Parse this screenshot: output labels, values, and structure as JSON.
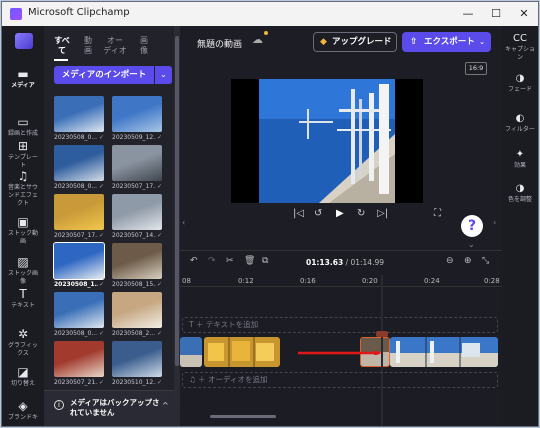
{
  "window": {
    "title": "Microsoft Clipchamp",
    "minimize": "—",
    "maximize": "☐",
    "close": "✕"
  },
  "rail": [
    {
      "icon": "media-folder-icon",
      "glyph": "▬",
      "label": "メディア",
      "active": true
    },
    {
      "icon": "record-create-icon",
      "glyph": "▭",
      "label": "録画と作成"
    },
    {
      "icon": "templates-icon",
      "glyph": "⊞",
      "label": "テンプレー\nト"
    },
    {
      "icon": "music-sfx-icon",
      "glyph": "♫",
      "label": "音楽とサウ\nンドエフェ\nクト"
    },
    {
      "icon": "stock-video-icon",
      "glyph": "▣",
      "label": "ストック動\n画"
    },
    {
      "icon": "stock-image-icon",
      "glyph": "▨",
      "label": "ストック画\n像"
    },
    {
      "icon": "text-icon",
      "glyph": "T",
      "label": "テキスト"
    },
    {
      "icon": "graphics-icon",
      "glyph": "✲",
      "label": "グラフィッ\nクス"
    },
    {
      "icon": "transitions-icon",
      "glyph": "◪",
      "label": "切り替え"
    },
    {
      "icon": "brand-kit-icon",
      "glyph": "◈",
      "label": "ブランドキ"
    }
  ],
  "media": {
    "tabs": [
      "すべて",
      "動\n画",
      "オー\nディオ",
      "画\n像"
    ],
    "import_label": "メディアのインポート",
    "import_dropdown": "⌄",
    "items": [
      {
        "name": "20230508_0...",
        "colors": [
          "#3a6fb8",
          "#dfe8f2"
        ]
      },
      {
        "name": "20230509_12...",
        "colors": [
          "#3f76c6",
          "#a8c7e6"
        ]
      },
      {
        "name": "20230508_0...",
        "colors": [
          "#2e5d9e",
          "#d5dde8"
        ]
      },
      {
        "name": "20230507_17...",
        "colors": [
          "#8a93a0",
          "#40474f"
        ]
      },
      {
        "name": "20230507_17...",
        "colors": [
          "#c99a3a",
          "#f0c84a"
        ]
      },
      {
        "name": "20230507_14...",
        "colors": [
          "#8f9aa8",
          "#e2e6ea"
        ]
      },
      {
        "name": "20230508_1...",
        "colors": [
          "#2d67c2",
          "#e8edf2"
        ],
        "selected": true
      },
      {
        "name": "20230508_15...",
        "colors": [
          "#6d5a48",
          "#d8d0c0"
        ]
      },
      {
        "name": "20230508_0...",
        "colors": [
          "#3a6fb8",
          "#e0e8f0"
        ]
      },
      {
        "name": "20230508_2...",
        "colors": [
          "#c6a782",
          "#f3eee6"
        ]
      },
      {
        "name": "20230507_21...",
        "colors": [
          "#a23a2e",
          "#e8d8c8"
        ]
      },
      {
        "name": "20230510_12...",
        "colors": [
          "#3b5d8e",
          "#cfdbe8"
        ]
      }
    ],
    "check": "✓",
    "backup_text": "メディアはバックアップされていません",
    "backup_icon": "i",
    "backup_caret": "^"
  },
  "topbar": {
    "project_title": "無題の動画",
    "upgrade_label": "アップグレード",
    "upgrade_icon": "◆",
    "export_label": "エクスポート",
    "export_icon": "⇧",
    "export_caret": "⌄"
  },
  "player": {
    "ratio": "16:9",
    "controls": {
      "prev": "|◁",
      "rew": "↺",
      "play": "▶",
      "fwd": "↻",
      "next": "▷|",
      "fullscreen": "⛶"
    },
    "help": "?"
  },
  "props": [
    {
      "icon": "captions-icon",
      "glyph": "CC",
      "label": "キャプショ\nン"
    },
    {
      "icon": "fade-icon",
      "glyph": "◑",
      "label": "フェード"
    },
    {
      "icon": "filter-icon",
      "glyph": "◐",
      "label": "フィルター"
    },
    {
      "icon": "effects-icon",
      "glyph": "✦",
      "label": "効果"
    },
    {
      "icon": "adjust-color-icon",
      "glyph": "◑",
      "label": "色を調整"
    }
  ],
  "timeline": {
    "tools": {
      "undo": "↶",
      "redo": "↷",
      "split": "✂",
      "delete": "🗑",
      "duplicate": "⧉",
      "zoom_out": "⊖",
      "zoom_in": "⊕",
      "fit": "⤡"
    },
    "current_time": "01:13.63",
    "total_time": " / 01:14.99",
    "ticks": [
      "08",
      "0:12",
      "0:16",
      "0:20",
      "0:24",
      "0:28"
    ],
    "text_track": "T ＋ テキストを追加",
    "audio_track": "♫ ＋ オーディオを追加"
  }
}
